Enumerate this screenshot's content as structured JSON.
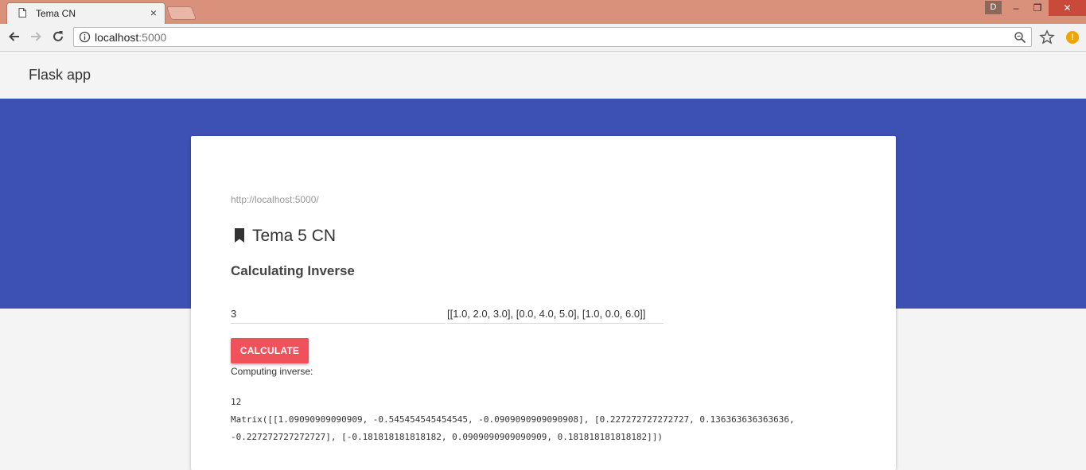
{
  "browser": {
    "tab_title": "Tema CN",
    "tab_close": "×",
    "user_badge": "D",
    "window_min": "–",
    "window_max": "❐",
    "window_close": "✕",
    "url_host": "localhost",
    "url_port": ":5000",
    "extension_badge": "!"
  },
  "header": {
    "brand": "Flask app"
  },
  "card": {
    "url": "http://localhost:5000/",
    "title": "Tema 5 CN",
    "subtitle": "Calculating Inverse",
    "size_value": "3",
    "matrix_value": "[[1.0, 2.0, 3.0], [0.0, 4.0, 5.0], [1.0, 0.0, 6.0]]",
    "button_label": "CALCULATE",
    "computing_label": "Computing inverse:",
    "result_count": "12",
    "result_line1": "Matrix([[1.09090909090909, -0.545454545454545, -0.0909090909090908], [0.227272727272727, 0.136363636363636,",
    "result_line2": "-0.227272727272727], [-0.181818181818182, 0.0909090909090909, 0.181818181818182]])"
  },
  "colors": {
    "titlebar": "#d9917b",
    "hero": "#3d51b5",
    "button": "#f0515a",
    "extension": "#f0a400"
  },
  "icons": [
    "page-icon",
    "close-icon",
    "back-icon",
    "forward-icon",
    "reload-icon",
    "info-icon",
    "zoom-icon",
    "star-icon",
    "bookmark-icon"
  ]
}
